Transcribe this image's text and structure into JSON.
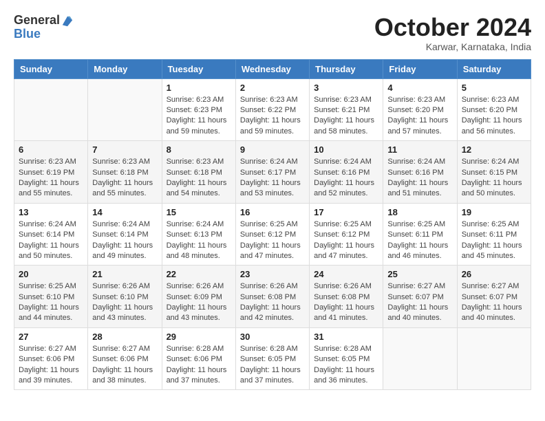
{
  "header": {
    "logo_general": "General",
    "logo_blue": "Blue",
    "month_title": "October 2024",
    "location": "Karwar, Karnataka, India"
  },
  "days_of_week": [
    "Sunday",
    "Monday",
    "Tuesday",
    "Wednesday",
    "Thursday",
    "Friday",
    "Saturday"
  ],
  "weeks": [
    [
      {
        "day": "",
        "info": ""
      },
      {
        "day": "",
        "info": ""
      },
      {
        "day": "1",
        "info": "Sunrise: 6:23 AM\nSunset: 6:23 PM\nDaylight: 11 hours and 59 minutes."
      },
      {
        "day": "2",
        "info": "Sunrise: 6:23 AM\nSunset: 6:22 PM\nDaylight: 11 hours and 59 minutes."
      },
      {
        "day": "3",
        "info": "Sunrise: 6:23 AM\nSunset: 6:21 PM\nDaylight: 11 hours and 58 minutes."
      },
      {
        "day": "4",
        "info": "Sunrise: 6:23 AM\nSunset: 6:20 PM\nDaylight: 11 hours and 57 minutes."
      },
      {
        "day": "5",
        "info": "Sunrise: 6:23 AM\nSunset: 6:20 PM\nDaylight: 11 hours and 56 minutes."
      }
    ],
    [
      {
        "day": "6",
        "info": "Sunrise: 6:23 AM\nSunset: 6:19 PM\nDaylight: 11 hours and 55 minutes."
      },
      {
        "day": "7",
        "info": "Sunrise: 6:23 AM\nSunset: 6:18 PM\nDaylight: 11 hours and 55 minutes."
      },
      {
        "day": "8",
        "info": "Sunrise: 6:23 AM\nSunset: 6:18 PM\nDaylight: 11 hours and 54 minutes."
      },
      {
        "day": "9",
        "info": "Sunrise: 6:24 AM\nSunset: 6:17 PM\nDaylight: 11 hours and 53 minutes."
      },
      {
        "day": "10",
        "info": "Sunrise: 6:24 AM\nSunset: 6:16 PM\nDaylight: 11 hours and 52 minutes."
      },
      {
        "day": "11",
        "info": "Sunrise: 6:24 AM\nSunset: 6:16 PM\nDaylight: 11 hours and 51 minutes."
      },
      {
        "day": "12",
        "info": "Sunrise: 6:24 AM\nSunset: 6:15 PM\nDaylight: 11 hours and 50 minutes."
      }
    ],
    [
      {
        "day": "13",
        "info": "Sunrise: 6:24 AM\nSunset: 6:14 PM\nDaylight: 11 hours and 50 minutes."
      },
      {
        "day": "14",
        "info": "Sunrise: 6:24 AM\nSunset: 6:14 PM\nDaylight: 11 hours and 49 minutes."
      },
      {
        "day": "15",
        "info": "Sunrise: 6:24 AM\nSunset: 6:13 PM\nDaylight: 11 hours and 48 minutes."
      },
      {
        "day": "16",
        "info": "Sunrise: 6:25 AM\nSunset: 6:12 PM\nDaylight: 11 hours and 47 minutes."
      },
      {
        "day": "17",
        "info": "Sunrise: 6:25 AM\nSunset: 6:12 PM\nDaylight: 11 hours and 47 minutes."
      },
      {
        "day": "18",
        "info": "Sunrise: 6:25 AM\nSunset: 6:11 PM\nDaylight: 11 hours and 46 minutes."
      },
      {
        "day": "19",
        "info": "Sunrise: 6:25 AM\nSunset: 6:11 PM\nDaylight: 11 hours and 45 minutes."
      }
    ],
    [
      {
        "day": "20",
        "info": "Sunrise: 6:25 AM\nSunset: 6:10 PM\nDaylight: 11 hours and 44 minutes."
      },
      {
        "day": "21",
        "info": "Sunrise: 6:26 AM\nSunset: 6:10 PM\nDaylight: 11 hours and 43 minutes."
      },
      {
        "day": "22",
        "info": "Sunrise: 6:26 AM\nSunset: 6:09 PM\nDaylight: 11 hours and 43 minutes."
      },
      {
        "day": "23",
        "info": "Sunrise: 6:26 AM\nSunset: 6:08 PM\nDaylight: 11 hours and 42 minutes."
      },
      {
        "day": "24",
        "info": "Sunrise: 6:26 AM\nSunset: 6:08 PM\nDaylight: 11 hours and 41 minutes."
      },
      {
        "day": "25",
        "info": "Sunrise: 6:27 AM\nSunset: 6:07 PM\nDaylight: 11 hours and 40 minutes."
      },
      {
        "day": "26",
        "info": "Sunrise: 6:27 AM\nSunset: 6:07 PM\nDaylight: 11 hours and 40 minutes."
      }
    ],
    [
      {
        "day": "27",
        "info": "Sunrise: 6:27 AM\nSunset: 6:06 PM\nDaylight: 11 hours and 39 minutes."
      },
      {
        "day": "28",
        "info": "Sunrise: 6:27 AM\nSunset: 6:06 PM\nDaylight: 11 hours and 38 minutes."
      },
      {
        "day": "29",
        "info": "Sunrise: 6:28 AM\nSunset: 6:06 PM\nDaylight: 11 hours and 37 minutes."
      },
      {
        "day": "30",
        "info": "Sunrise: 6:28 AM\nSunset: 6:05 PM\nDaylight: 11 hours and 37 minutes."
      },
      {
        "day": "31",
        "info": "Sunrise: 6:28 AM\nSunset: 6:05 PM\nDaylight: 11 hours and 36 minutes."
      },
      {
        "day": "",
        "info": ""
      },
      {
        "day": "",
        "info": ""
      }
    ]
  ]
}
